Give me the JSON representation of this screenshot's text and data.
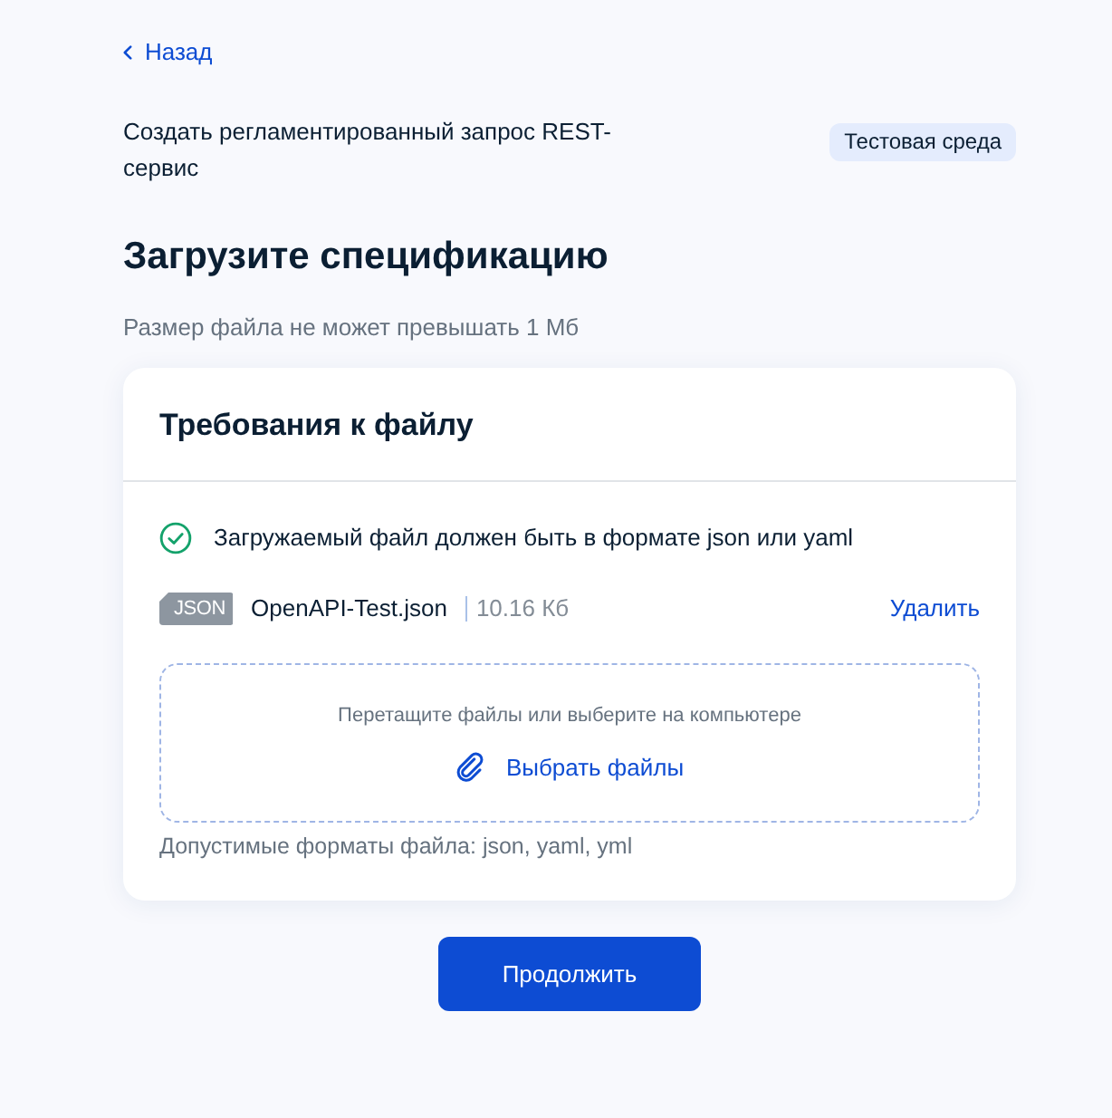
{
  "back_link": {
    "label": "Назад"
  },
  "header": {
    "title": "Создать регламентированный запрос REST-сервис",
    "environment_badge": "Тестовая среда"
  },
  "page": {
    "heading": "Загрузите спецификацию",
    "subtitle": "Размер файла не может превышать 1 Мб"
  },
  "card": {
    "title": "Требования к файлу",
    "requirements": [
      {
        "text": "Загружаемый файл должен быть в формате json или yaml",
        "met": true
      }
    ],
    "files": [
      {
        "type_label": "JSON",
        "name": "OpenAPI-Test.json",
        "size": "10.16 Кб",
        "action": "Удалить"
      }
    ],
    "dropzone": {
      "hint": "Перетащите файлы или выберите на компьютере",
      "button": "Выбрать файлы"
    },
    "formats_note": "Допустимые форматы файла: json, yaml, yml"
  },
  "primary_button": "Продолжить"
}
